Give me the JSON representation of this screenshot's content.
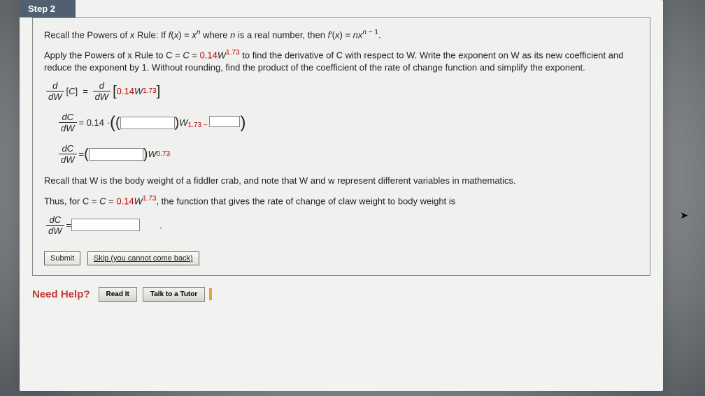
{
  "step": {
    "label": "Step 2"
  },
  "content": {
    "recall": "Recall the Powers of x Rule: If f(x) = xⁿ where n is a real number, then f'(x) = nxⁿ ⁻ ¹.",
    "apply1": "Apply the Powers of x Rule to C = ",
    "c_coeff": "0.14",
    "c_var": "W",
    "c_exp": "1.73",
    "apply2": " to find the derivative of C with respect to W. Write the exponent on W as its new coefficient and reduce the exponent by 1. Without rounding, find the product of the coefficient of the rate of change function and simplify the exponent.",
    "eq1_left_num": "d",
    "eq1_left_den": "dW",
    "eq1_mid": "[C] = ",
    "eq1_right_bracket": "0.14W",
    "eq1_right_exp": "1.73",
    "eq2_frac_num": "dC",
    "eq2_frac_den": "dW",
    "eq2_eq": " = 0.14 · ",
    "eq2_w": "W",
    "eq2_exp_base": "1.73 − ",
    "eq3_frac_num": "dC",
    "eq3_frac_den": "dW",
    "eq3_eq": " = ",
    "eq3_w": "W",
    "eq3_exp": "0.73",
    "note": "Recall that W is the body weight of a fiddler crab, and note that W and w represent different variables in mathematics.",
    "thus1": "Thus, for C = ",
    "thus_exp": "1.73",
    "thus2": ", the function that gives the rate of change of claw weight to body weight is",
    "final_num": "dC",
    "final_den": "dW",
    "final_eq": " = ",
    "final_period": "."
  },
  "buttons": {
    "submit": "Submit",
    "skip": "Skip (you cannot come back)"
  },
  "help": {
    "need": "Need Help?",
    "read": "Read It",
    "tutor": "Talk to a Tutor"
  }
}
